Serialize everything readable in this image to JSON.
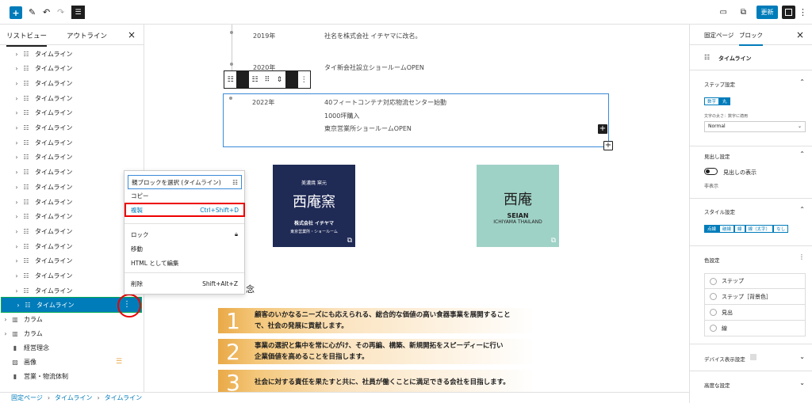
{
  "toolbar": {
    "update": "更新"
  },
  "listview": {
    "tab_list": "リストビュー",
    "tab_outline": "アウトライン",
    "items": [
      "タイムライン",
      "タイムライン",
      "タイムライン",
      "タイムライン",
      "タイムライン",
      "タイムライン",
      "タイムライン",
      "タイムライン",
      "タイムライン",
      "タイムライン",
      "タイムライン",
      "タイムライン",
      "タイムライン",
      "タイムライン",
      "タイムライン",
      "タイムライン",
      "タイムライン"
    ],
    "selected": "タイムライン",
    "col1": "カラム",
    "col2": "カラム",
    "p1": "経営理念",
    "p2": "画像",
    "p3": "営業・物流体制"
  },
  "timeline": [
    {
      "year": "2019年",
      "lines": [
        "社名を株式会社 イチヤマに改名。"
      ]
    },
    {
      "year": "2020年",
      "lines": [
        "タイ新会社設立ショールームOPEN"
      ]
    },
    {
      "year": "2022年",
      "lines": [
        "40フィートコンテナ対応物流センター始動",
        "1000坪購入",
        "東京営業所ショールームOPEN"
      ]
    }
  ],
  "logo1": {
    "line1": "美濃焼 窯元",
    "name": "西庵窯",
    "company": "株式会社 イチヤマ",
    "sub": "東京営業所・ショールーム"
  },
  "logo2": {
    "name": "西庵",
    "en": "SEIAN",
    "sub": "ICHIYAMA THAILAND"
  },
  "heading_char": "念",
  "principles": [
    {
      "num": "1",
      "text": "顧客のいかなるニーズにも応えられる、総合的な価値の高い食器事業を展開すること\nで、社会の発展に貢献します。"
    },
    {
      "num": "2",
      "text": "事業の選択と集中を常に心がけ、その再編、構築、新規開拓をスピーディーに行い\n企業価値を高めることを目指します。"
    },
    {
      "num": "3",
      "text": "社会に対する責任を果たすと共に、社員が働くことに満足できる会社を目指します。"
    }
  ],
  "menu": {
    "select_parent": "親ブロックを選択 (タイムライン)",
    "copy": "コピー",
    "duplicate": "複製",
    "duplicate_sc": "Ctrl+Shift+D",
    "lock": "ロック",
    "move": "移動",
    "edit_html": "HTML として編集",
    "delete": "削除",
    "delete_sc": "Shift+Alt+Z"
  },
  "settings": {
    "tab_page": "固定ページ",
    "tab_block": "ブロック",
    "block_name": "タイムライン",
    "step": "ステップ設定",
    "size_label": "文字の太さ：数字に適用",
    "size_value": "Normal",
    "seg1": [
      "数字",
      "丸"
    ],
    "heading": "見出し設定",
    "toggle_label": "見出しの表示",
    "hidden": "非表示",
    "style": "スタイル設定",
    "seg2": [
      "点線",
      "破線",
      "線",
      "線（太字）",
      "なし"
    ],
    "color": "色設定",
    "colors": [
      "ステップ",
      "ステップ［背景色］",
      "見出",
      "線"
    ],
    "device": "デバイス表示設定",
    "advanced": "高度な設定"
  },
  "breadcrumb": [
    "固定ページ",
    "タイムライン",
    "タイムライン"
  ]
}
